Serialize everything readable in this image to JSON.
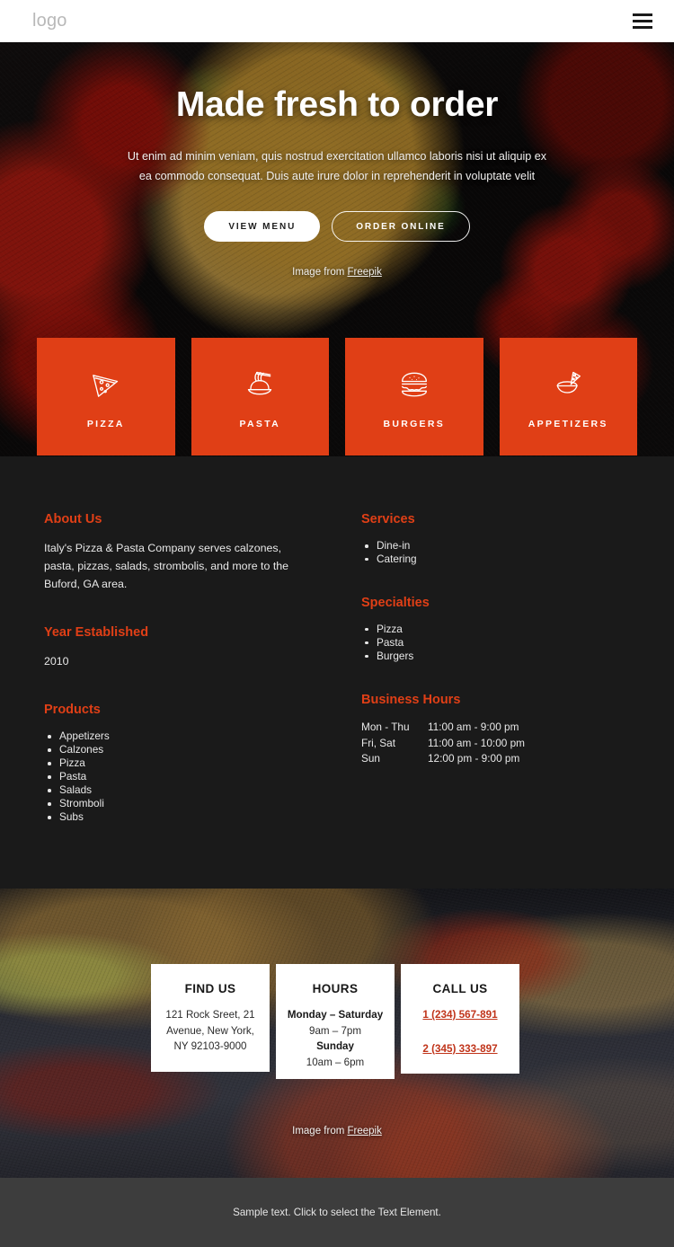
{
  "header": {
    "logo": "logo",
    "menu_icon": "hamburger-icon"
  },
  "hero": {
    "title": "Made fresh to order",
    "subtitle": "Ut enim ad minim veniam, quis nostrud exercitation ullamco laboris nisi ut aliquip ex ea commodo consequat. Duis aute irure dolor in reprehenderit in voluptate velit",
    "primary_button": "VIEW MENU",
    "secondary_button": "ORDER ONLINE",
    "credit_prefix": "Image from ",
    "credit_link": "Freepik"
  },
  "categories": [
    {
      "label": "PIZZA",
      "icon": "pizza-slice-icon"
    },
    {
      "label": "PASTA",
      "icon": "pasta-bowl-icon"
    },
    {
      "label": "BURGERS",
      "icon": "burger-icon"
    },
    {
      "label": "APPETIZERS",
      "icon": "nachos-bowl-icon"
    }
  ],
  "info": {
    "about": {
      "heading": "About Us",
      "text": "Italy's Pizza & Pasta Company serves calzones, pasta, pizzas, salads, strombolis, and more to the Buford, GA area."
    },
    "year": {
      "heading": "Year Established",
      "value": "2010"
    },
    "products": {
      "heading": "Products",
      "items": [
        "Appetizers",
        "Calzones",
        "Pizza",
        "Pasta",
        "Salads",
        "Stromboli",
        "Subs"
      ]
    },
    "services": {
      "heading": "Services",
      "items": [
        "Dine-in",
        "Catering"
      ]
    },
    "specialties": {
      "heading": "Specialties",
      "items": [
        "Pizza",
        "Pasta",
        "Burgers"
      ]
    },
    "business_hours": {
      "heading": "Business Hours",
      "rows": [
        {
          "day": "Mon - Thu",
          "time": "11:00 am - 9:00 pm"
        },
        {
          "day": "Fri, Sat",
          "time": "11:00 am - 10:00 pm"
        },
        {
          "day": "Sun",
          "time": "12:00 pm - 9:00 pm"
        }
      ]
    }
  },
  "contact": {
    "find_us": {
      "title": "FIND US",
      "line1": "121 Rock Sreet, 21",
      "line2": "Avenue, New York,",
      "line3": "NY 92103-9000"
    },
    "hours": {
      "title": "HOURS",
      "weekday_label": "Monday – Saturday",
      "weekday_time": "9am – 7pm",
      "weekend_label": "Sunday",
      "weekend_time": "10am – 6pm"
    },
    "call_us": {
      "title": "CALL US",
      "phone1": "1 (234) 567-891",
      "phone2": "2 (345) 333-897"
    },
    "credit_prefix": "Image from ",
    "credit_link": "Freepik"
  },
  "footer": {
    "text": "Sample text. Click to select the Text Element."
  },
  "colors": {
    "accent": "#E03F16",
    "dark_section": "#1A1A1A",
    "footer": "#3D3D3D",
    "phone_link": "#C0341A"
  }
}
